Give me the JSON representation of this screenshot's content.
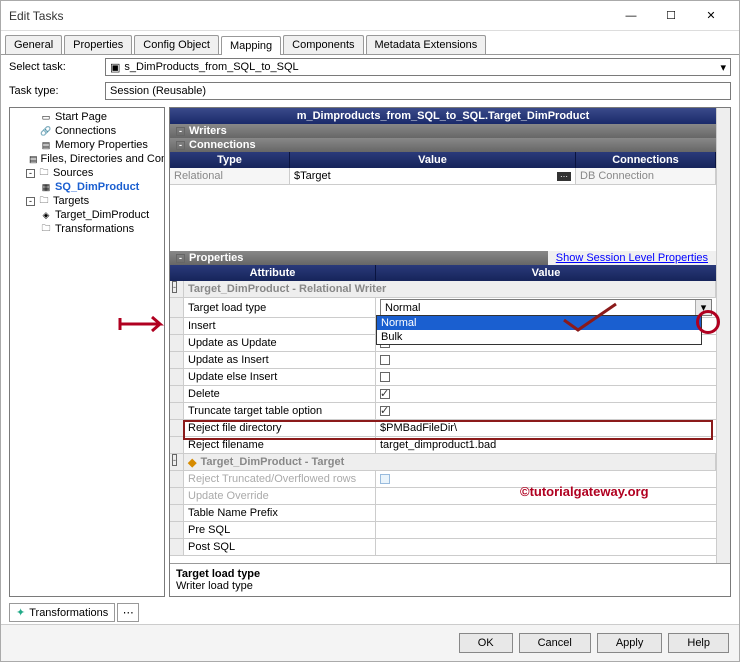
{
  "window_title": "Edit Tasks",
  "tabs": [
    "General",
    "Properties",
    "Config Object",
    "Mapping",
    "Components",
    "Metadata Extensions"
  ],
  "active_tab": 3,
  "select_task_label": "Select task:",
  "select_task_value": "s_DimProducts_from_SQL_to_SQL",
  "task_type_label": "Task type:",
  "task_type_value": "Session (Reusable)",
  "tree": {
    "items": [
      {
        "label": "Start Page",
        "lvl": 1,
        "icon": "page"
      },
      {
        "label": "Connections",
        "lvl": 1,
        "icon": "conn"
      },
      {
        "label": "Memory Properties",
        "lvl": 1,
        "icon": "mem"
      },
      {
        "label": "Files, Directories and Com",
        "lvl": 1,
        "icon": "file"
      },
      {
        "label": "Sources",
        "lvl": 1,
        "icon": "folder",
        "exp": true
      },
      {
        "label": "SQ_DimProduct",
        "lvl": 2,
        "icon": "src",
        "bold": true,
        "color": "#1b5fd0"
      },
      {
        "label": "Targets",
        "lvl": 1,
        "icon": "folder",
        "exp": true
      },
      {
        "label": "Target_DimProduct",
        "lvl": 2,
        "icon": "tgt"
      },
      {
        "label": "Transformations",
        "lvl": 1,
        "icon": "folder"
      }
    ]
  },
  "mapping_title": "m_Dimproducts_from_SQL_to_SQL.Target_DimProduct",
  "writers_label": "Writers",
  "connections_label": "Connections",
  "grid_headers": [
    "Type",
    "Value",
    "Connections"
  ],
  "grid_row": {
    "type": "Relational",
    "value": "$Target",
    "conn": "DB Connection"
  },
  "properties_label": "Properties",
  "session_link": "Show Session Level Properties",
  "attr_header": "Attribute",
  "val_header": "Value",
  "group1": "Target_DimProduct - Relational Writer",
  "rows": [
    {
      "attr": "Target load type",
      "val": "Normal",
      "dropdown": true
    },
    {
      "attr": "Insert",
      "chk": true,
      "hidden": true
    },
    {
      "attr": "Update as Update",
      "chk": true,
      "hidden": true
    },
    {
      "attr": "Update as Insert",
      "chk": false
    },
    {
      "attr": "Update else Insert",
      "chk": false
    },
    {
      "attr": "Delete",
      "chk": true
    },
    {
      "attr": "Truncate target table option",
      "chk": true
    },
    {
      "attr": "Reject file directory",
      "val": "$PMBadFileDir\\"
    },
    {
      "attr": "Reject filename",
      "val": "target_dimproduct1.bad"
    }
  ],
  "dd_options": [
    "Normal",
    "Bulk"
  ],
  "group2": "Target_DimProduct - Target",
  "rows2": [
    {
      "attr": "Reject Truncated/Overflowed rows",
      "light": true,
      "grey": true
    },
    {
      "attr": "Update Override",
      "grey": true
    },
    {
      "attr": "Table Name Prefix"
    },
    {
      "attr": "Pre SQL"
    },
    {
      "attr": "Post SQL"
    }
  ],
  "desc_title": "Target load type",
  "desc_text": "Writer load type",
  "bottom_tab": "Transformations",
  "buttons": {
    "ok": "OK",
    "cancel": "Cancel",
    "apply": "Apply",
    "help": "Help"
  },
  "watermark": "©tutorialgateway.org"
}
